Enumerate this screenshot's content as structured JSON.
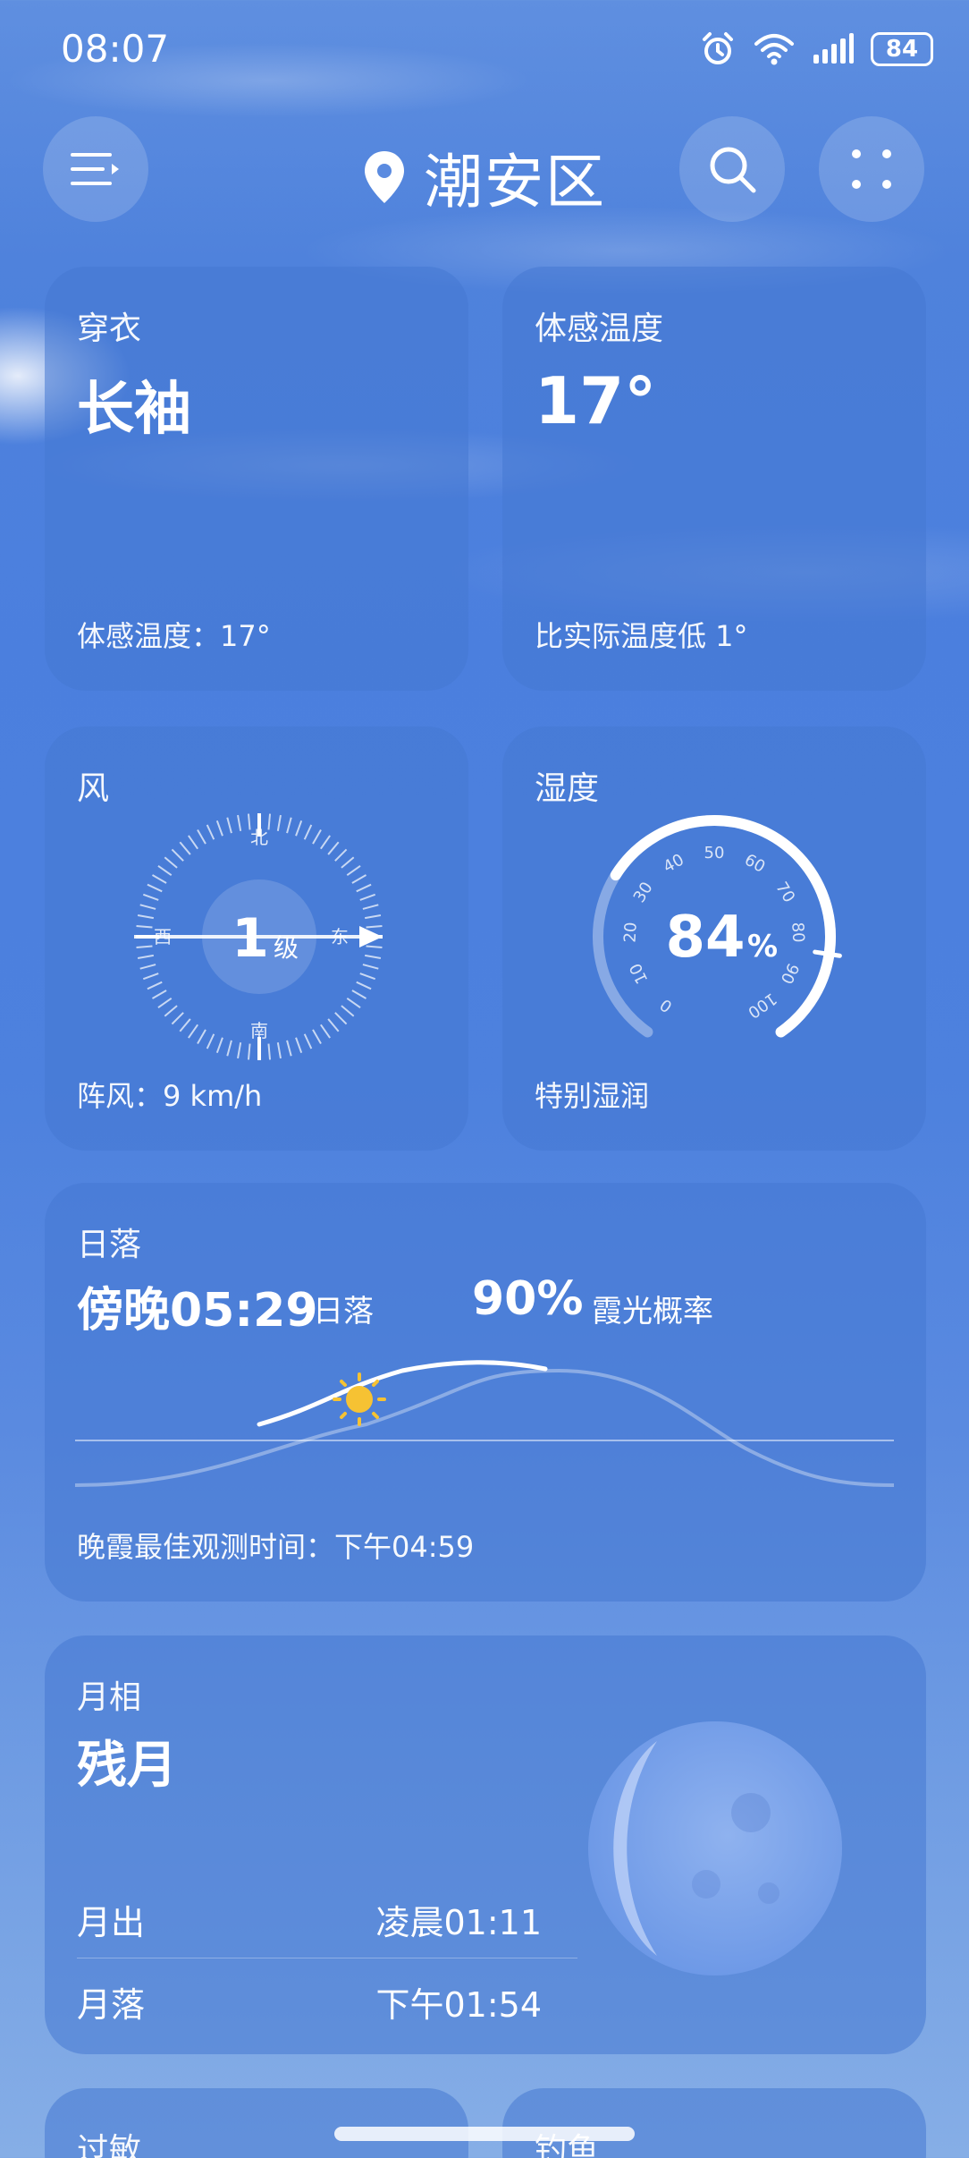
{
  "status_bar": {
    "time": "08:07",
    "battery": "84",
    "icons": [
      "alarm-icon",
      "wifi-icon",
      "signal-icon",
      "battery-icon"
    ]
  },
  "header": {
    "location": "潮安区",
    "icons": [
      "menu-icon",
      "location-pin-icon",
      "search-icon",
      "more-icon"
    ]
  },
  "clothing": {
    "title": "穿衣",
    "value": "长袖",
    "footer": "体感温度：17°"
  },
  "feels_like": {
    "title": "体感温度",
    "value": "17°",
    "footer": "比实际温度低 1°"
  },
  "wind": {
    "title": "风",
    "level_number": "1",
    "level_unit": "级",
    "north": "北",
    "south": "南",
    "west": "西",
    "east": "东",
    "footer": "阵风：9 km/h"
  },
  "humidity": {
    "title": "湿度",
    "value_number": "84",
    "value_unit": "%",
    "percent": 84,
    "scale_labels": [
      "0",
      "10",
      "20",
      "30",
      "40",
      "50",
      "60",
      "70",
      "80",
      "90",
      "100"
    ],
    "footer": "特别湿润"
  },
  "sunset": {
    "title": "日落",
    "time": "傍晚05:29",
    "time_label": "日落",
    "probability": "90%",
    "probability_label": "霞光概率",
    "footer": "晚霞最佳观测时间：下午04:59"
  },
  "moon": {
    "title": "月相",
    "phase": "残月",
    "rise_label": "月出",
    "rise_time": "凌晨01:11",
    "set_label": "月落",
    "set_time": "下午01:54"
  },
  "bottom_cards": {
    "left_title": "过敏",
    "right_title": "钓鱼"
  },
  "colors": {
    "accent_sun": "#f6c233",
    "card_bg": "#4678d2"
  }
}
